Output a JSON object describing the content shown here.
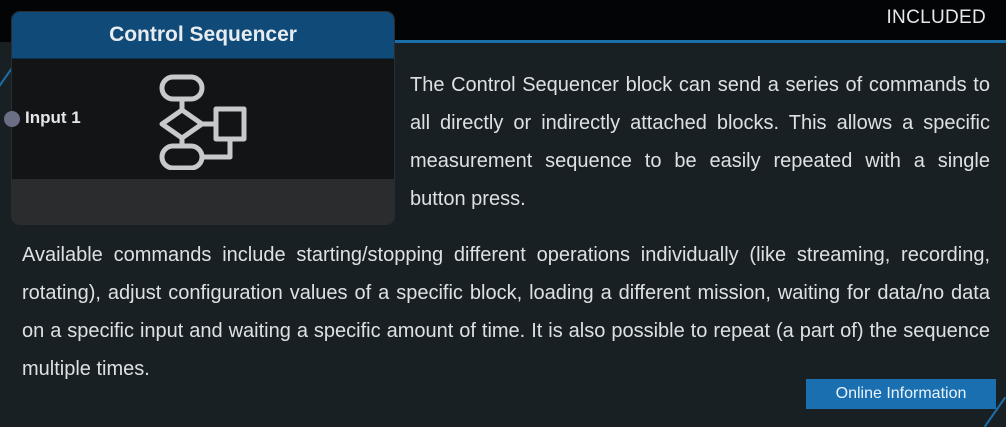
{
  "header": {
    "badge": "INCLUDED"
  },
  "block": {
    "title": "Control Sequencer",
    "input_label": "Input 1",
    "icon": "flowchart-icon"
  },
  "description": {
    "paragraph_1": "The Control Sequencer block can send a series of commands to all directly or indirectly attached blocks. This allows a specific measurement sequence to be easily repeated with a single button press.",
    "paragraph_2": "Available commands include starting/stopping different operations individually (like streaming, recording, rotating), adjust configuration values of a specific block, loading a different mission, waiting for data/no data on a specific input and waiting a specific amount of time. It is also possible to repeat (a part of) the sequence multiple times."
  },
  "actions": {
    "online_info_label": "Online Information"
  },
  "colors": {
    "accent": "#1b6fa8",
    "header_blue": "#0f4a78",
    "background": "#182023",
    "button": "#1a6fb0"
  }
}
